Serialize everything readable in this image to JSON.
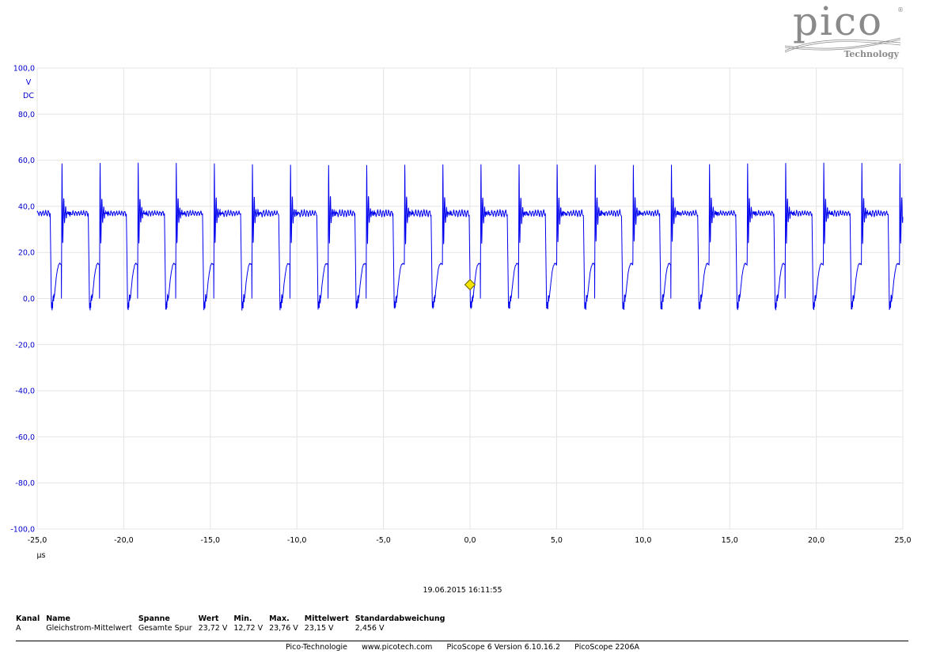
{
  "logo": {
    "brand": "pico",
    "sub": "Technology",
    "reg": "®"
  },
  "colors": {
    "trace": "#0000ee",
    "axis_text": "#0000cc",
    "grid": "#e4e4e4",
    "trigger": "#f2e300"
  },
  "chart_data": {
    "type": "line",
    "title": "",
    "x_unit": "µs",
    "y_unit": "V",
    "y_coupling": "DC",
    "xlim": [
      -25,
      25
    ],
    "ylim": [
      -100,
      100
    ],
    "x_ticks": [
      -25,
      -20,
      -15,
      -10,
      -5,
      0,
      5,
      10,
      15,
      20,
      25
    ],
    "y_ticks": [
      -100,
      -80,
      -60,
      -40,
      -20,
      0,
      20,
      40,
      60,
      80,
      100
    ],
    "x_tick_labels": [
      "-25,0",
      "-20,0",
      "-15,0",
      "-10,0",
      "-5,0",
      "0,0",
      "5,0",
      "10,0",
      "15,0",
      "20,0",
      "25,0"
    ],
    "y_tick_labels": [
      "-100,0",
      "-80,0",
      "-60,0",
      "-40,0",
      "-20,0",
      "0,0",
      "20,0",
      "40,0",
      "60,0",
      "80,0",
      "100,0"
    ],
    "grid": true,
    "trigger": {
      "x": 0.0,
      "y": 6.0
    },
    "series": [
      {
        "waveform": "periodic switching square wave with ringing",
        "period": 2.2,
        "first_rising_edge": -23.6,
        "high_level": 37,
        "low_level": 0,
        "peak_overshoot": 59,
        "dip_min": 12.5,
        "undershoot": -3
      }
    ]
  },
  "timestamp": "19.06.2015 16:11:55",
  "measurements": {
    "headers": [
      "Kanal",
      "Name",
      "Spanne",
      "Wert",
      "Min.",
      "Max.",
      "Mittelwert",
      "Standardabweichung"
    ],
    "rows": [
      [
        "A",
        "Gleichstrom-Mittelwert",
        "Gesamte Spur",
        "23,72 V",
        "12,72 V",
        "23,76 V",
        "23,15 V",
        "2,456 V"
      ]
    ]
  },
  "footer": {
    "company": "Pico-Technologie",
    "url": "www.picotech.com",
    "software": "PicoScope 6 Version 6.10.16.2",
    "device": "PicoScope 2206A"
  }
}
